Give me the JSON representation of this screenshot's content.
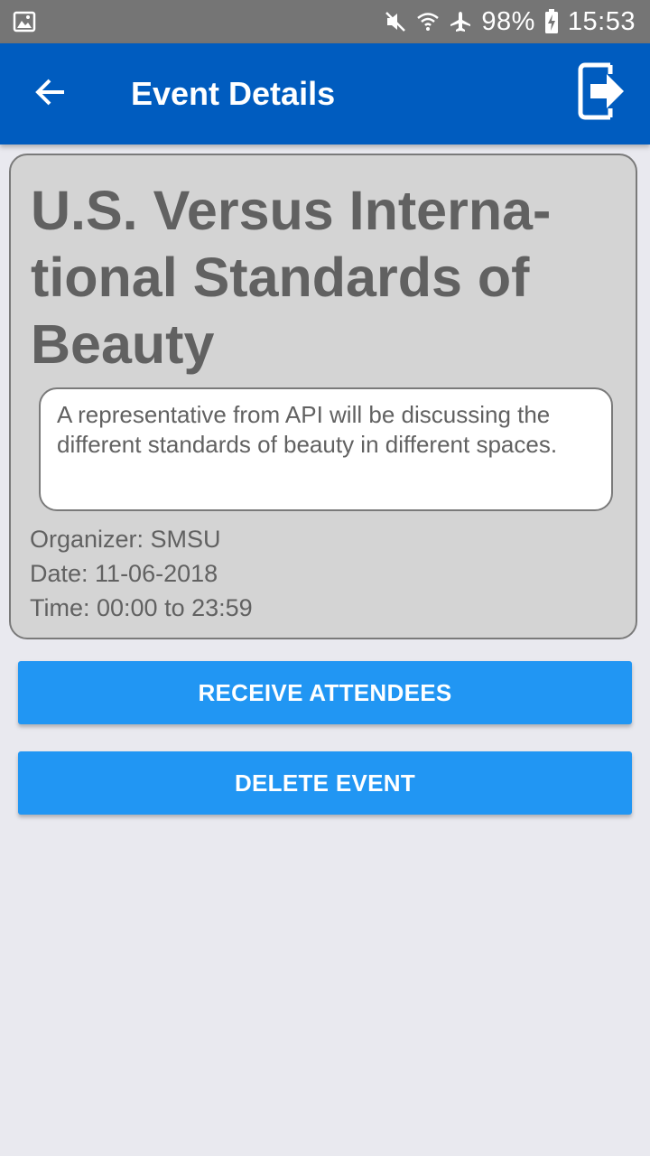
{
  "status_bar": {
    "battery": "98%",
    "time": "15:53",
    "icons": [
      "image-icon",
      "mute-icon",
      "wifi-icon",
      "airplane-icon",
      "battery-charging-icon"
    ]
  },
  "app_bar": {
    "title": "Event Details",
    "back_icon": "arrow-left-icon",
    "logout_icon": "exit-icon"
  },
  "event": {
    "title": "U.S. Versus Interna-tional Standards of Beauty",
    "description": "A representative from API will be discussing the different standards of beauty in different spaces.",
    "organizer": "Organizer: SMSU",
    "date": "Date: 11-06-2018",
    "time": "Time: 00:00 to 23:59"
  },
  "actions": {
    "receive_label": "RECEIVE ATTENDEES",
    "delete_label": "DELETE EVENT"
  },
  "colors": {
    "status_bar": "#757575",
    "app_bar": "#005cbf",
    "button": "#2196f3",
    "card": "#d4d4d4",
    "background": "#e9e9ef",
    "text": "#616161"
  }
}
